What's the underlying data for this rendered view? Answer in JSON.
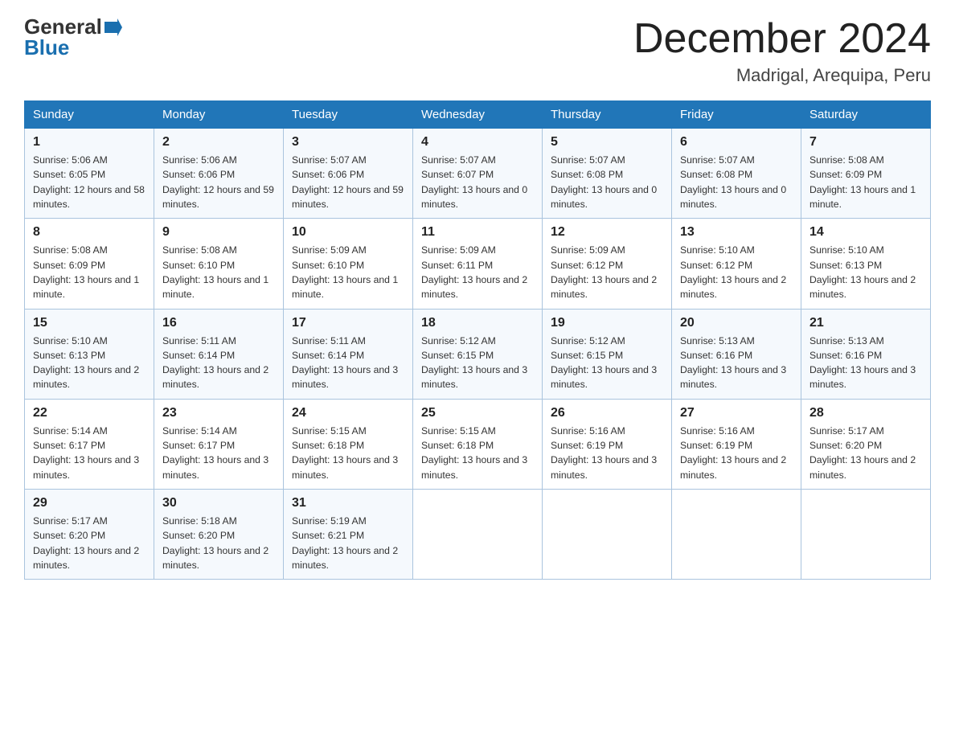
{
  "header": {
    "logo_general": "General",
    "logo_blue": "Blue",
    "month_title": "December 2024",
    "location": "Madrigal, Arequipa, Peru"
  },
  "days_of_week": [
    "Sunday",
    "Monday",
    "Tuesday",
    "Wednesday",
    "Thursday",
    "Friday",
    "Saturday"
  ],
  "weeks": [
    [
      {
        "day": "1",
        "sunrise": "5:06 AM",
        "sunset": "6:05 PM",
        "daylight": "12 hours and 58 minutes."
      },
      {
        "day": "2",
        "sunrise": "5:06 AM",
        "sunset": "6:06 PM",
        "daylight": "12 hours and 59 minutes."
      },
      {
        "day": "3",
        "sunrise": "5:07 AM",
        "sunset": "6:06 PM",
        "daylight": "12 hours and 59 minutes."
      },
      {
        "day": "4",
        "sunrise": "5:07 AM",
        "sunset": "6:07 PM",
        "daylight": "13 hours and 0 minutes."
      },
      {
        "day": "5",
        "sunrise": "5:07 AM",
        "sunset": "6:08 PM",
        "daylight": "13 hours and 0 minutes."
      },
      {
        "day": "6",
        "sunrise": "5:07 AM",
        "sunset": "6:08 PM",
        "daylight": "13 hours and 0 minutes."
      },
      {
        "day": "7",
        "sunrise": "5:08 AM",
        "sunset": "6:09 PM",
        "daylight": "13 hours and 1 minute."
      }
    ],
    [
      {
        "day": "8",
        "sunrise": "5:08 AM",
        "sunset": "6:09 PM",
        "daylight": "13 hours and 1 minute."
      },
      {
        "day": "9",
        "sunrise": "5:08 AM",
        "sunset": "6:10 PM",
        "daylight": "13 hours and 1 minute."
      },
      {
        "day": "10",
        "sunrise": "5:09 AM",
        "sunset": "6:10 PM",
        "daylight": "13 hours and 1 minute."
      },
      {
        "day": "11",
        "sunrise": "5:09 AM",
        "sunset": "6:11 PM",
        "daylight": "13 hours and 2 minutes."
      },
      {
        "day": "12",
        "sunrise": "5:09 AM",
        "sunset": "6:12 PM",
        "daylight": "13 hours and 2 minutes."
      },
      {
        "day": "13",
        "sunrise": "5:10 AM",
        "sunset": "6:12 PM",
        "daylight": "13 hours and 2 minutes."
      },
      {
        "day": "14",
        "sunrise": "5:10 AM",
        "sunset": "6:13 PM",
        "daylight": "13 hours and 2 minutes."
      }
    ],
    [
      {
        "day": "15",
        "sunrise": "5:10 AM",
        "sunset": "6:13 PM",
        "daylight": "13 hours and 2 minutes."
      },
      {
        "day": "16",
        "sunrise": "5:11 AM",
        "sunset": "6:14 PM",
        "daylight": "13 hours and 2 minutes."
      },
      {
        "day": "17",
        "sunrise": "5:11 AM",
        "sunset": "6:14 PM",
        "daylight": "13 hours and 3 minutes."
      },
      {
        "day": "18",
        "sunrise": "5:12 AM",
        "sunset": "6:15 PM",
        "daylight": "13 hours and 3 minutes."
      },
      {
        "day": "19",
        "sunrise": "5:12 AM",
        "sunset": "6:15 PM",
        "daylight": "13 hours and 3 minutes."
      },
      {
        "day": "20",
        "sunrise": "5:13 AM",
        "sunset": "6:16 PM",
        "daylight": "13 hours and 3 minutes."
      },
      {
        "day": "21",
        "sunrise": "5:13 AM",
        "sunset": "6:16 PM",
        "daylight": "13 hours and 3 minutes."
      }
    ],
    [
      {
        "day": "22",
        "sunrise": "5:14 AM",
        "sunset": "6:17 PM",
        "daylight": "13 hours and 3 minutes."
      },
      {
        "day": "23",
        "sunrise": "5:14 AM",
        "sunset": "6:17 PM",
        "daylight": "13 hours and 3 minutes."
      },
      {
        "day": "24",
        "sunrise": "5:15 AM",
        "sunset": "6:18 PM",
        "daylight": "13 hours and 3 minutes."
      },
      {
        "day": "25",
        "sunrise": "5:15 AM",
        "sunset": "6:18 PM",
        "daylight": "13 hours and 3 minutes."
      },
      {
        "day": "26",
        "sunrise": "5:16 AM",
        "sunset": "6:19 PM",
        "daylight": "13 hours and 3 minutes."
      },
      {
        "day": "27",
        "sunrise": "5:16 AM",
        "sunset": "6:19 PM",
        "daylight": "13 hours and 2 minutes."
      },
      {
        "day": "28",
        "sunrise": "5:17 AM",
        "sunset": "6:20 PM",
        "daylight": "13 hours and 2 minutes."
      }
    ],
    [
      {
        "day": "29",
        "sunrise": "5:17 AM",
        "sunset": "6:20 PM",
        "daylight": "13 hours and 2 minutes."
      },
      {
        "day": "30",
        "sunrise": "5:18 AM",
        "sunset": "6:20 PM",
        "daylight": "13 hours and 2 minutes."
      },
      {
        "day": "31",
        "sunrise": "5:19 AM",
        "sunset": "6:21 PM",
        "daylight": "13 hours and 2 minutes."
      },
      null,
      null,
      null,
      null
    ]
  ],
  "labels": {
    "sunrise": "Sunrise:",
    "sunset": "Sunset:",
    "daylight": "Daylight:"
  }
}
